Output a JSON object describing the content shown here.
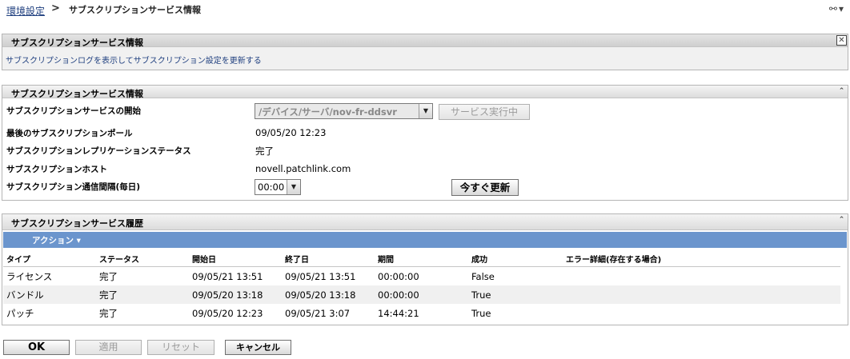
{
  "breadcrumb": {
    "link": "環境設定",
    "separator": ">",
    "current": "サブスクリプションサービス情報"
  },
  "tools": {
    "icons": [
      "link-icon",
      "menu-arrow-icon"
    ],
    "glyphs": "⚯ ▾"
  },
  "info_panel": {
    "title": "サブスクリプションサービス情報",
    "close_glyph": "✕",
    "description": "サブスクリプションログを表示してサブスクリプション設定を更新する"
  },
  "service_panel": {
    "title": "サブスクリプションサービス情報",
    "collapse_glyph": "⌃",
    "rows": {
      "start_label": "サブスクリプションサービスの開始",
      "start_select_value": "/デバイス/サーバ/nov-fr-ddsvr",
      "start_button": "サービス実行中",
      "last_poll_label": "最後のサブスクリプションポール",
      "last_poll_value": "09/05/20 12:23",
      "replication_label": "サブスクリプションレプリケーションステータス",
      "replication_value": "完了",
      "host_label": "サブスクリプションホスト",
      "host_value": "novell.patchlink.com",
      "interval_label": "サブスクリプション通信間隔(毎日)",
      "interval_value": "00:00",
      "update_button": "今すぐ更新"
    }
  },
  "history_panel": {
    "title": "サブスクリプションサービス履歴",
    "collapse_glyph": "⌃",
    "action_label": "アクション ▾",
    "columns": [
      "タイプ",
      "ステータス",
      "開始日",
      "終了日",
      "期間",
      "成功",
      "エラー詳細(存在する場合)"
    ],
    "rows": [
      [
        "ライセンス",
        "完了",
        "09/05/21 13:51",
        "09/05/21 13:51",
        "00:00:00",
        "False",
        ""
      ],
      [
        "バンドル",
        "完了",
        "09/05/20 13:18",
        "09/05/20 13:18",
        "00:00:00",
        "True",
        ""
      ],
      [
        "パッチ",
        "完了",
        "09/05/20 12:23",
        "09/05/21 3:07",
        "14:44:21",
        "True",
        ""
      ]
    ]
  },
  "buttons": {
    "ok": "OK",
    "apply": "適用",
    "reset": "リセット",
    "cancel": "キャンセル"
  },
  "colors": {
    "action_bar": "#6b95cd",
    "link": "#1f3f7f"
  }
}
